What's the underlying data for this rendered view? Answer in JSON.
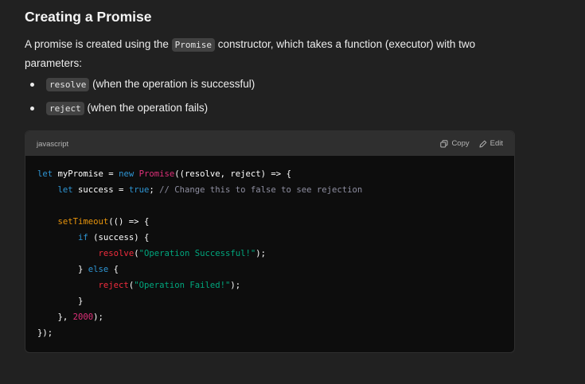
{
  "heading": "Creating a Promise",
  "intro": {
    "before": "A promise is created using the ",
    "code": "Promise",
    "after": " constructor, which takes a function (executor) with two parameters:"
  },
  "bullets": [
    {
      "code": "resolve",
      "text": " (when the operation is successful)"
    },
    {
      "code": "reject",
      "text": " (when the operation fails)"
    }
  ],
  "code_block": {
    "language": "javascript",
    "copy_label": "Copy",
    "edit_label": "Edit",
    "lines": [
      "let myPromise = new Promise((resolve, reject) => {",
      "    let success = true; // Change this to false to see rejection",
      "",
      "    setTimeout(() => {",
      "        if (success) {",
      "            resolve(\"Operation Successful!\");",
      "        } else {",
      "            reject(\"Operation Failed!\");",
      "        }",
      "    }, 2000);",
      "});"
    ]
  },
  "colors": {
    "background": "#212121",
    "code_background": "#0d0d0d",
    "code_header": "#2f2f2f",
    "keyword": "#2e95d3",
    "string": "#00a67d",
    "number": "#df3079"
  },
  "icons": [
    "copy-icon",
    "edit-icon"
  ]
}
